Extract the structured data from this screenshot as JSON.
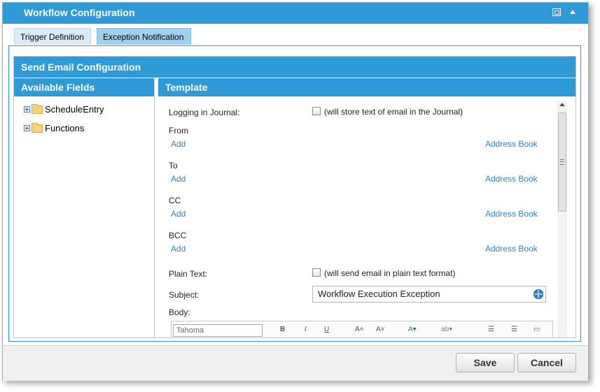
{
  "dialog": {
    "title": "Workflow Configuration"
  },
  "tabs": [
    {
      "label": "Trigger Definition"
    },
    {
      "label": "Exception Notification",
      "active": true
    }
  ],
  "section": {
    "title": "Send Email Configuration"
  },
  "available_fields": {
    "header": "Available Fields",
    "items": [
      {
        "label": "ScheduleEntry"
      },
      {
        "label": "Functions"
      }
    ]
  },
  "template": {
    "header": "Template",
    "logging": {
      "label": "Logging in Journal:",
      "checkbox_text": "(will store text of email in the Journal)",
      "checked": false
    },
    "from": {
      "label": "From",
      "add": "Add",
      "address_book": "Address Book"
    },
    "to": {
      "label": "To",
      "add": "Add",
      "address_book": "Address Book"
    },
    "cc": {
      "label": "CC",
      "add": "Add",
      "address_book": "Address Book"
    },
    "bcc": {
      "label": "BCC",
      "add": "Add",
      "address_book": "Address Book"
    },
    "plain_text": {
      "label": "Plain Text:",
      "checkbox_text": "(will send email in plain text format)",
      "checked": false
    },
    "subject": {
      "label": "Subject:",
      "value": "Workflow Execution Exception"
    },
    "body": {
      "label": "Body:",
      "font": "Tahoma"
    }
  },
  "footer": {
    "save": "Save",
    "cancel": "Cancel"
  },
  "colors": {
    "accent": "#2e9ad7",
    "link": "#2f84c2"
  }
}
